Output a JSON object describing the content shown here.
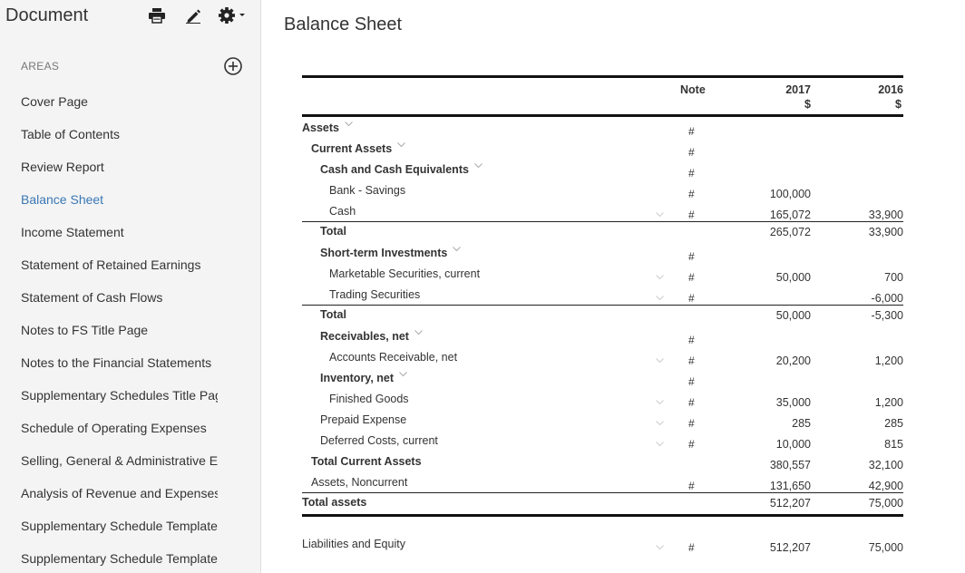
{
  "sidebar": {
    "doc_title": "Document",
    "areas_label": "AREAS",
    "items": [
      {
        "label": "Cover Page"
      },
      {
        "label": "Table of Contents"
      },
      {
        "label": "Review Report"
      },
      {
        "label": "Balance Sheet"
      },
      {
        "label": "Income Statement"
      },
      {
        "label": "Statement of Retained Earnings"
      },
      {
        "label": "Statement of Cash Flows"
      },
      {
        "label": "Notes to FS Title Page"
      },
      {
        "label": "Notes to the Financial Statements"
      },
      {
        "label": "Supplementary Schedules Title Pag"
      },
      {
        "label": "Schedule of Operating Expenses"
      },
      {
        "label": "Selling, General & Administrative E"
      },
      {
        "label": "Analysis of Revenue and Expenses"
      },
      {
        "label": "Supplementary Schedule Template"
      },
      {
        "label": "Supplementary Schedule Template"
      }
    ],
    "active_index": 3,
    "icons": [
      "print-icon",
      "edit-icon",
      "gear-icon",
      "add-circle-icon"
    ]
  },
  "main": {
    "title": "Balance Sheet",
    "header": {
      "note": "Note",
      "year1": "2017",
      "year2": "2016",
      "currency1": "$",
      "currency2": "$"
    },
    "rows": [
      {
        "label": "Assets",
        "bold": true,
        "chevron": true,
        "hash": "#",
        "v1": "",
        "v2": ""
      },
      {
        "label": "Current Assets",
        "bold": true,
        "chevron": true,
        "hash": "#",
        "v1": "",
        "v2": ""
      },
      {
        "label": "Cash and Cash Equivalents",
        "bold": true,
        "chevron": true,
        "hash": "#",
        "v1": "",
        "v2": ""
      },
      {
        "label": "Bank - Savings",
        "hash": "#",
        "v1": "100,000",
        "v2": ""
      },
      {
        "label": "Cash",
        "hash": "#",
        "rchev": true,
        "v1": "165,072",
        "v2": "33,900"
      },
      {
        "label": "Total",
        "bold": true,
        "total": true,
        "hash": "",
        "v1": "265,072",
        "v2": "33,900"
      },
      {
        "label": "Short-term Investments",
        "bold": true,
        "chevron": true,
        "hash": "#",
        "v1": "",
        "v2": ""
      },
      {
        "label": "Marketable Securities, current",
        "hash": "#",
        "rchev": true,
        "v1": "50,000",
        "v2": "700"
      },
      {
        "label": "Trading Securities",
        "hash": "#",
        "rchev": true,
        "v1": "",
        "v2": "-6,000"
      },
      {
        "label": "Total",
        "bold": true,
        "total": true,
        "hash": "",
        "v1": "50,000",
        "v2": "-5,300"
      },
      {
        "label": "Receivables, net",
        "bold": true,
        "chevron": true,
        "hash": "#",
        "v1": "",
        "v2": ""
      },
      {
        "label": "Accounts Receivable, net",
        "hash": "#",
        "rchev": true,
        "v1": "20,200",
        "v2": "1,200"
      },
      {
        "label": "Inventory, net",
        "bold": true,
        "chevron": true,
        "hash": "#",
        "v1": "",
        "v2": ""
      },
      {
        "label": "Finished Goods",
        "hash": "#",
        "rchev": true,
        "v1": "35,000",
        "v2": "1,200"
      },
      {
        "label": "Prepaid Expense",
        "hash": "#",
        "rchev": true,
        "v1": "285",
        "v2": "285"
      },
      {
        "label": "Deferred Costs, current",
        "hash": "#",
        "rchev": true,
        "v1": "10,000",
        "v2": "815"
      },
      {
        "label": "Total Current Assets",
        "bold": true,
        "hash": "",
        "v1": "380,557",
        "v2": "32,100"
      },
      {
        "label": "Assets, Noncurrent",
        "hash": "#",
        "v1": "131,650",
        "v2": "42,900"
      },
      {
        "label": "Total assets",
        "bold": true,
        "total": true,
        "hash": "",
        "v1": "512,207",
        "v2": "75,000"
      }
    ],
    "footer_row": {
      "label": "Liabilities and Equity",
      "hash": "#",
      "v1": "512,207",
      "v2": "75,000"
    }
  }
}
